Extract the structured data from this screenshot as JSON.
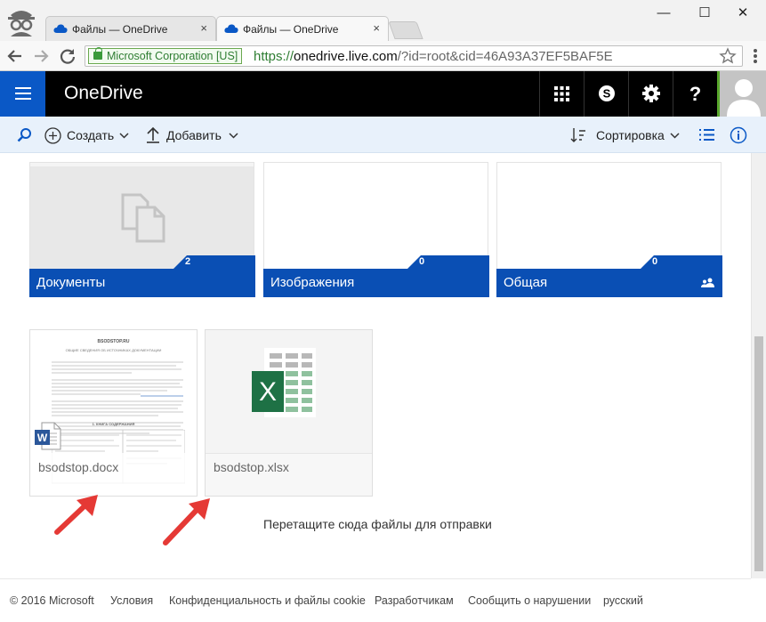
{
  "browser": {
    "tabs": [
      {
        "title": "Файлы — OneDrive",
        "active": false
      },
      {
        "title": "Файлы — OneDrive",
        "active": true
      }
    ],
    "tab_close_glyph": "×",
    "window_controls": {
      "minimize": "—",
      "maximize": "☐",
      "close": "✕"
    },
    "address": {
      "ev_label": "Microsoft Corporation [US]",
      "url_scheme": "https://",
      "url_host": "onedrive.live.com",
      "url_rest": "/?id=root&cid=46A93A37EF5BAF5E"
    }
  },
  "header": {
    "brand": "OneDrive",
    "icons": [
      "app-launcher-icon",
      "skype-icon",
      "settings-icon",
      "help-icon",
      "avatar"
    ],
    "help_glyph": "?"
  },
  "commands": {
    "create": "Создать",
    "add": "Добавить",
    "sort": "Сортировка"
  },
  "folders": [
    {
      "name": "Документы",
      "count": "2",
      "shared": false
    },
    {
      "name": "Изображения",
      "count": "0",
      "shared": false
    },
    {
      "name": "Общая",
      "count": "0",
      "shared": true
    }
  ],
  "files": [
    {
      "name": "bsodstop.docx",
      "type": "word",
      "doc_title": "BSODSTOP.RU",
      "doc_subtitle": "ОБЩИЕ СВЕДЕНИЯ ОБ ИСТОЧНИКАХ ДОКУМЕНТАЦИИ",
      "doc_section": "1. КНИГА СОДЕРЖАНИЯ"
    },
    {
      "name": "bsodstop.xlsx",
      "type": "excel"
    }
  ],
  "drop_hint": "Перетащите сюда файлы для отправки",
  "footer": {
    "copyright": "© 2016 Microsoft",
    "links": [
      "Условия",
      "Конфиденциальность и файлы cookie",
      "Разработчикам",
      "Сообщить о нарушении",
      "русский"
    ]
  },
  "colors": {
    "brand_blue": "#0a58c6",
    "folder_bar": "#0a4fb4",
    "cmdbar_bg": "#e8f1fb",
    "excel_green": "#1e7145",
    "word_blue": "#2b579a",
    "arrow_red": "#e53935"
  }
}
